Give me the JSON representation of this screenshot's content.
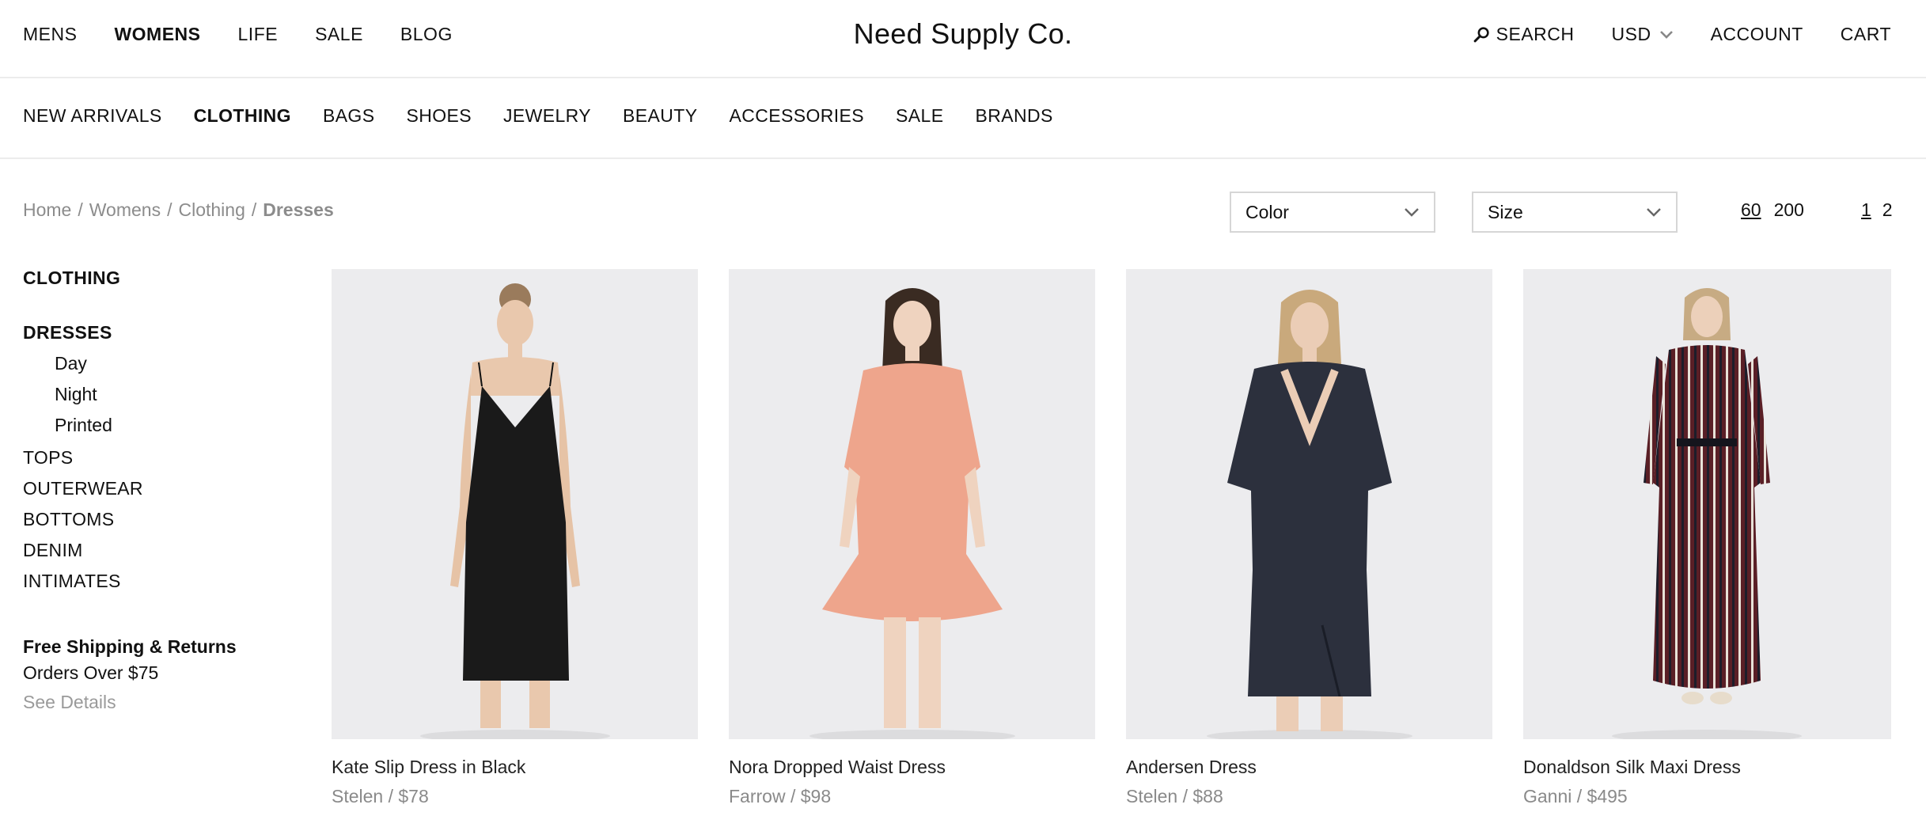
{
  "header": {
    "nav": [
      "MENS",
      "WOMENS",
      "LIFE",
      "SALE",
      "BLOG"
    ],
    "active_nav": "WOMENS",
    "brand": "Need Supply Co.",
    "search_label": "SEARCH",
    "currency": "USD",
    "account_label": "ACCOUNT",
    "cart_label": "CART"
  },
  "categories": {
    "items": [
      "NEW ARRIVALS",
      "CLOTHING",
      "BAGS",
      "SHOES",
      "JEWELRY",
      "BEAUTY",
      "ACCESSORIES",
      "SALE",
      "BRANDS"
    ],
    "active": "CLOTHING"
  },
  "breadcrumb": {
    "items": [
      "Home",
      "Womens",
      "Clothing"
    ],
    "separator": "/",
    "current": "Dresses"
  },
  "filters": {
    "color_label": "Color",
    "size_label": "Size",
    "per_page": [
      "60",
      "200"
    ],
    "per_page_active": "60",
    "pages": [
      "1",
      "2"
    ],
    "page_active": "1"
  },
  "sidebar": {
    "heading": "CLOTHING",
    "section": "DRESSES",
    "subitems": [
      "Day",
      "Night",
      "Printed"
    ],
    "items": [
      "TOPS",
      "OUTERWEAR",
      "BOTTOMS",
      "DENIM",
      "INTIMATES"
    ]
  },
  "promo": {
    "title": "Free Shipping & Returns",
    "line": "Orders Over $75",
    "link": "See Details"
  },
  "products": [
    {
      "name": "Kate Slip Dress in Black",
      "meta": "Stelen / $78",
      "dress_color": "#1a1a1a"
    },
    {
      "name": "Nora Dropped Waist Dress",
      "meta": "Farrow / $98",
      "dress_color": "#eea58c"
    },
    {
      "name": "Andersen Dress",
      "meta": "Stelen / $88",
      "dress_color": "#2c303d"
    },
    {
      "name": "Donaldson Silk Maxi Dress",
      "meta": "Ganni / $495",
      "dress_color": "#5a1f26"
    }
  ],
  "colors": {
    "text": "#111111",
    "muted": "#8c8c8c",
    "divider": "#ececec",
    "photo_bg": "#ececee"
  }
}
